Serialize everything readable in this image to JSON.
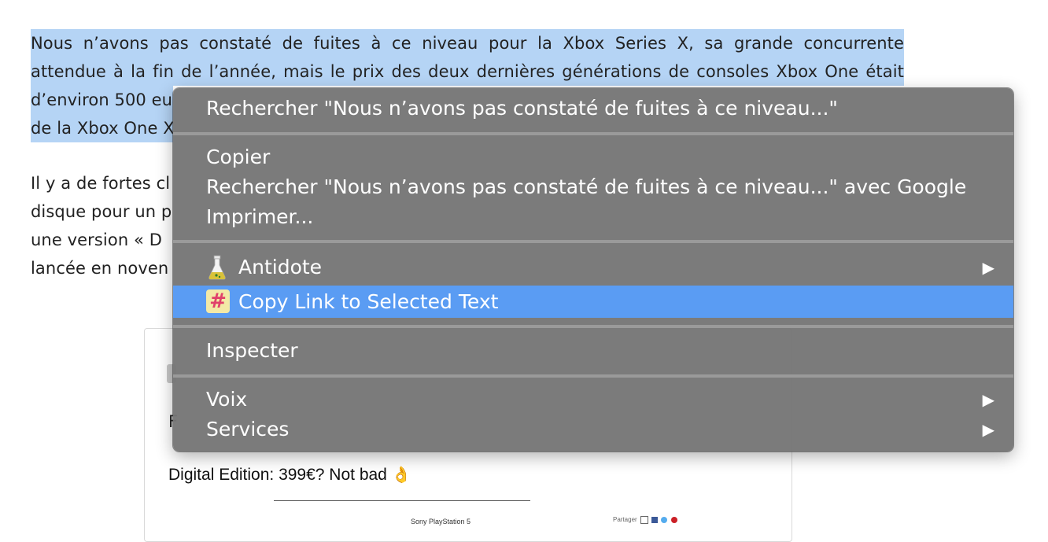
{
  "article": {
    "para1_lines": [
      "Nous n’avons pas constaté de fuites à ce niveau pour la Xbox Series X, sa grande concurrente",
      "attendue à la fin de l’année, mais le prix des deux dernières générations de consoles Xbox One était",
      "d’environ 500 eu",
      "de la Xbox One X"
    ],
    "para2_lines": [
      "Il y a de fortes cl",
      "disque pour un p",
      "une version « D",
      "lancée en noven"
    ]
  },
  "embed": {
    "letter": "F",
    "text": "Digital Edition: 399€? Not bad",
    "emoji": "👌",
    "caption": "Sony PlayStation 5",
    "share_label": "Partager"
  },
  "context_menu": {
    "search_label": "Rechercher \"Nous n’avons pas constaté de fuites à ce niveau...\"",
    "copy_label": "Copier",
    "search_google_label": "Rechercher \"Nous n’avons pas constaté de fuites à ce niveau...\" avec Google",
    "print_label": "Imprimer...",
    "antidote_label": "Antidote",
    "copy_link_label": "Copy Link to Selected Text",
    "inspect_label": "Inspecter",
    "voice_label": "Voix",
    "services_label": "Services",
    "submenu_arrow": "▶",
    "hash_glyph": "#",
    "highlight_color": "#5a9cf3",
    "selection_color": "#b5d4f5"
  }
}
